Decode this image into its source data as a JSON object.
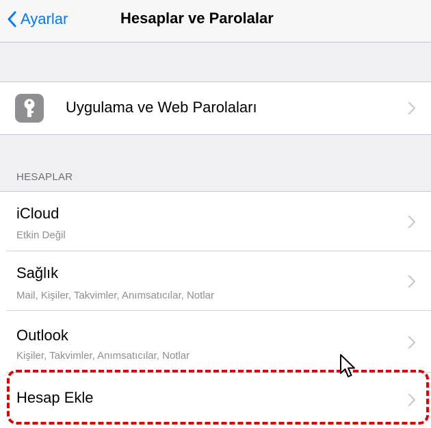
{
  "nav": {
    "back_label": "Ayarlar",
    "title": "Hesaplar ve Parolalar"
  },
  "passwords_row": {
    "icon": "key-icon",
    "label": "Uygulama ve Web Parolaları"
  },
  "accounts_section": {
    "header": "HESAPLAR",
    "accounts": [
      {
        "name": "iCloud",
        "detail": "Etkin Değil"
      },
      {
        "name": "Sağlık",
        "detail": "Mail, Kişiler, Takvimler, Anımsatıcılar, Notlar"
      },
      {
        "name": "Outlook",
        "detail": "Kişiler, Takvimler, Anımsatıcılar, Notlar"
      }
    ],
    "add_account_label": "Hesap Ekle"
  },
  "colors": {
    "accent": "#007aff",
    "highlight": "#e00000",
    "key_tile": "#8e8e93"
  }
}
